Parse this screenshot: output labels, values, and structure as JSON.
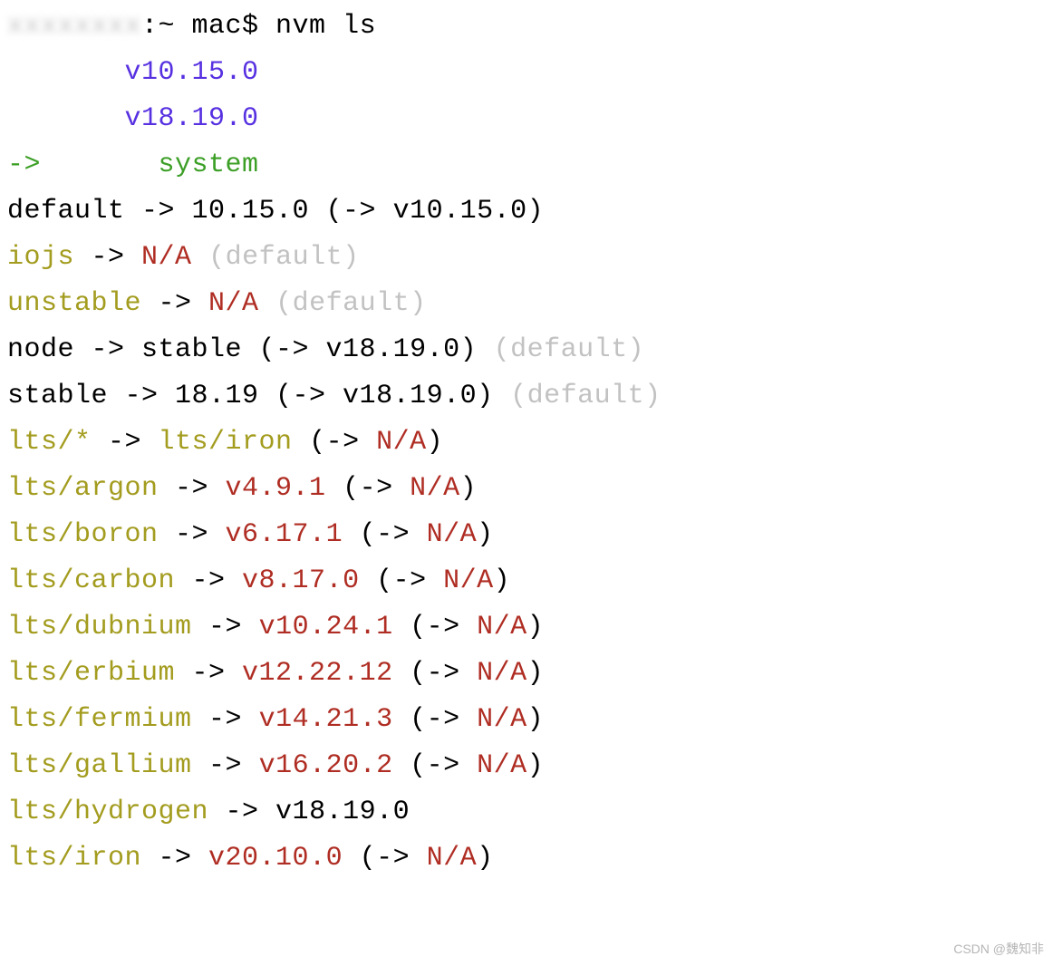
{
  "lines": [
    [
      {
        "cls": "blurred",
        "text": "xxxxxxxx"
      },
      {
        "cls": "c-black",
        "text": ":~ mac$ nvm ls"
      }
    ],
    [
      {
        "cls": "c-black",
        "text": "       "
      },
      {
        "cls": "c-blue",
        "text": "v10.15.0"
      }
    ],
    [
      {
        "cls": "c-black",
        "text": "       "
      },
      {
        "cls": "c-blue",
        "text": "v18.19.0"
      }
    ],
    [
      {
        "cls": "c-green",
        "text": "->"
      },
      {
        "cls": "c-black",
        "text": "       "
      },
      {
        "cls": "c-green",
        "text": "system"
      }
    ],
    [
      {
        "cls": "c-black",
        "text": "default -> 10.15.0 (-> v10.15.0)"
      }
    ],
    [
      {
        "cls": "c-olive",
        "text": "iojs"
      },
      {
        "cls": "c-black",
        "text": " -> "
      },
      {
        "cls": "c-red",
        "text": "N/A"
      },
      {
        "cls": "c-black",
        "text": " "
      },
      {
        "cls": "c-dim",
        "text": "(default)"
      }
    ],
    [
      {
        "cls": "c-olive",
        "text": "unstable"
      },
      {
        "cls": "c-black",
        "text": " -> "
      },
      {
        "cls": "c-red",
        "text": "N/A"
      },
      {
        "cls": "c-black",
        "text": " "
      },
      {
        "cls": "c-dim",
        "text": "(default)"
      }
    ],
    [
      {
        "cls": "c-black",
        "text": "node -> stable (-> v18.19.0) "
      },
      {
        "cls": "c-dim",
        "text": "(default)"
      }
    ],
    [
      {
        "cls": "c-black",
        "text": "stable -> 18.19 (-> v18.19.0) "
      },
      {
        "cls": "c-dim",
        "text": "(default)"
      }
    ],
    [
      {
        "cls": "c-olive",
        "text": "lts/*"
      },
      {
        "cls": "c-black",
        "text": " -> "
      },
      {
        "cls": "c-olive",
        "text": "lts/iron"
      },
      {
        "cls": "c-black",
        "text": " (-> "
      },
      {
        "cls": "c-red",
        "text": "N/A"
      },
      {
        "cls": "c-black",
        "text": ")"
      }
    ],
    [
      {
        "cls": "c-olive",
        "text": "lts/argon"
      },
      {
        "cls": "c-black",
        "text": " -> "
      },
      {
        "cls": "c-red",
        "text": "v4.9.1"
      },
      {
        "cls": "c-black",
        "text": " (-> "
      },
      {
        "cls": "c-red",
        "text": "N/A"
      },
      {
        "cls": "c-black",
        "text": ")"
      }
    ],
    [
      {
        "cls": "c-olive",
        "text": "lts/boron"
      },
      {
        "cls": "c-black",
        "text": " -> "
      },
      {
        "cls": "c-red",
        "text": "v6.17.1"
      },
      {
        "cls": "c-black",
        "text": " (-> "
      },
      {
        "cls": "c-red",
        "text": "N/A"
      },
      {
        "cls": "c-black",
        "text": ")"
      }
    ],
    [
      {
        "cls": "c-olive",
        "text": "lts/carbon"
      },
      {
        "cls": "c-black",
        "text": " -> "
      },
      {
        "cls": "c-red",
        "text": "v8.17.0"
      },
      {
        "cls": "c-black",
        "text": " (-> "
      },
      {
        "cls": "c-red",
        "text": "N/A"
      },
      {
        "cls": "c-black",
        "text": ")"
      }
    ],
    [
      {
        "cls": "c-olive",
        "text": "lts/dubnium"
      },
      {
        "cls": "c-black",
        "text": " -> "
      },
      {
        "cls": "c-red",
        "text": "v10.24.1"
      },
      {
        "cls": "c-black",
        "text": " (-> "
      },
      {
        "cls": "c-red",
        "text": "N/A"
      },
      {
        "cls": "c-black",
        "text": ")"
      }
    ],
    [
      {
        "cls": "c-olive",
        "text": "lts/erbium"
      },
      {
        "cls": "c-black",
        "text": " -> "
      },
      {
        "cls": "c-red",
        "text": "v12.22.12"
      },
      {
        "cls": "c-black",
        "text": " (-> "
      },
      {
        "cls": "c-red",
        "text": "N/A"
      },
      {
        "cls": "c-black",
        "text": ")"
      }
    ],
    [
      {
        "cls": "c-olive",
        "text": "lts/fermium"
      },
      {
        "cls": "c-black",
        "text": " -> "
      },
      {
        "cls": "c-red",
        "text": "v14.21.3"
      },
      {
        "cls": "c-black",
        "text": " (-> "
      },
      {
        "cls": "c-red",
        "text": "N/A"
      },
      {
        "cls": "c-black",
        "text": ")"
      }
    ],
    [
      {
        "cls": "c-olive",
        "text": "lts/gallium"
      },
      {
        "cls": "c-black",
        "text": " -> "
      },
      {
        "cls": "c-red",
        "text": "v16.20.2"
      },
      {
        "cls": "c-black",
        "text": " (-> "
      },
      {
        "cls": "c-red",
        "text": "N/A"
      },
      {
        "cls": "c-black",
        "text": ")"
      }
    ],
    [
      {
        "cls": "c-olive",
        "text": "lts/hydrogen"
      },
      {
        "cls": "c-black",
        "text": " -> v18.19.0"
      }
    ],
    [
      {
        "cls": "c-olive",
        "text": "lts/iron"
      },
      {
        "cls": "c-black",
        "text": " -> "
      },
      {
        "cls": "c-red",
        "text": "v20.10.0"
      },
      {
        "cls": "c-black",
        "text": " (-> "
      },
      {
        "cls": "c-red",
        "text": "N/A"
      },
      {
        "cls": "c-black",
        "text": ")"
      }
    ]
  ],
  "watermark": "CSDN @魏知非"
}
